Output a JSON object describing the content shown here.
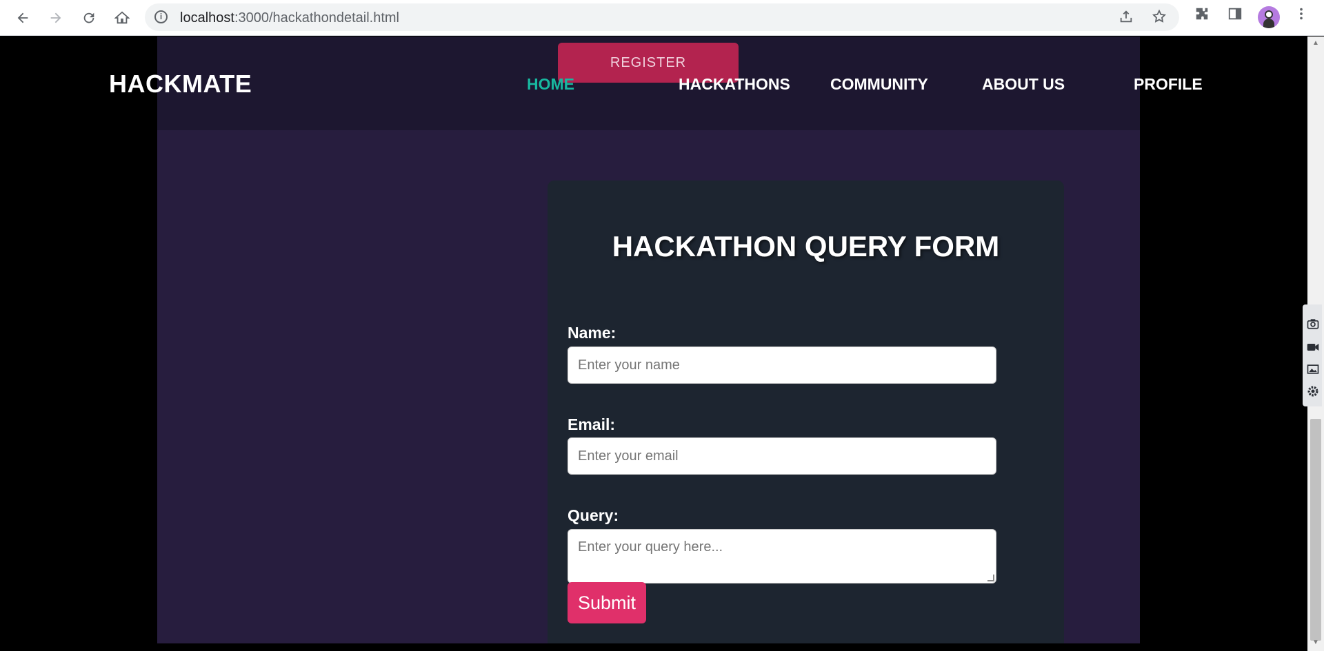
{
  "browser": {
    "url_host": "localhost",
    "url_path": ":3000/hackathondetail.html",
    "back_icon": "back-arrow-icon",
    "forward_icon": "forward-arrow-icon",
    "reload_icon": "reload-icon",
    "home_icon": "home-icon"
  },
  "site": {
    "logo": "HACKMATE",
    "register_label": "REGISTER",
    "nav": {
      "home": "HOME",
      "hackathons": "HACKATHONS",
      "community": "COMMUNITY",
      "about": "ABOUT US",
      "profile": "PROFILE"
    }
  },
  "form": {
    "title": "HACKATHON QUERY FORM",
    "name_label": "Name:",
    "name_placeholder": "Enter your name",
    "email_label": "Email:",
    "email_placeholder": "Enter your email",
    "query_label": "Query:",
    "query_placeholder": "Enter your query here...",
    "submit_label": "Submit"
  },
  "colors": {
    "accent_active": "#18b8a0",
    "register": "#b3234f",
    "submit": "#e0306a",
    "page_bg": "#271d3e",
    "card_bg": "#1d2530"
  }
}
